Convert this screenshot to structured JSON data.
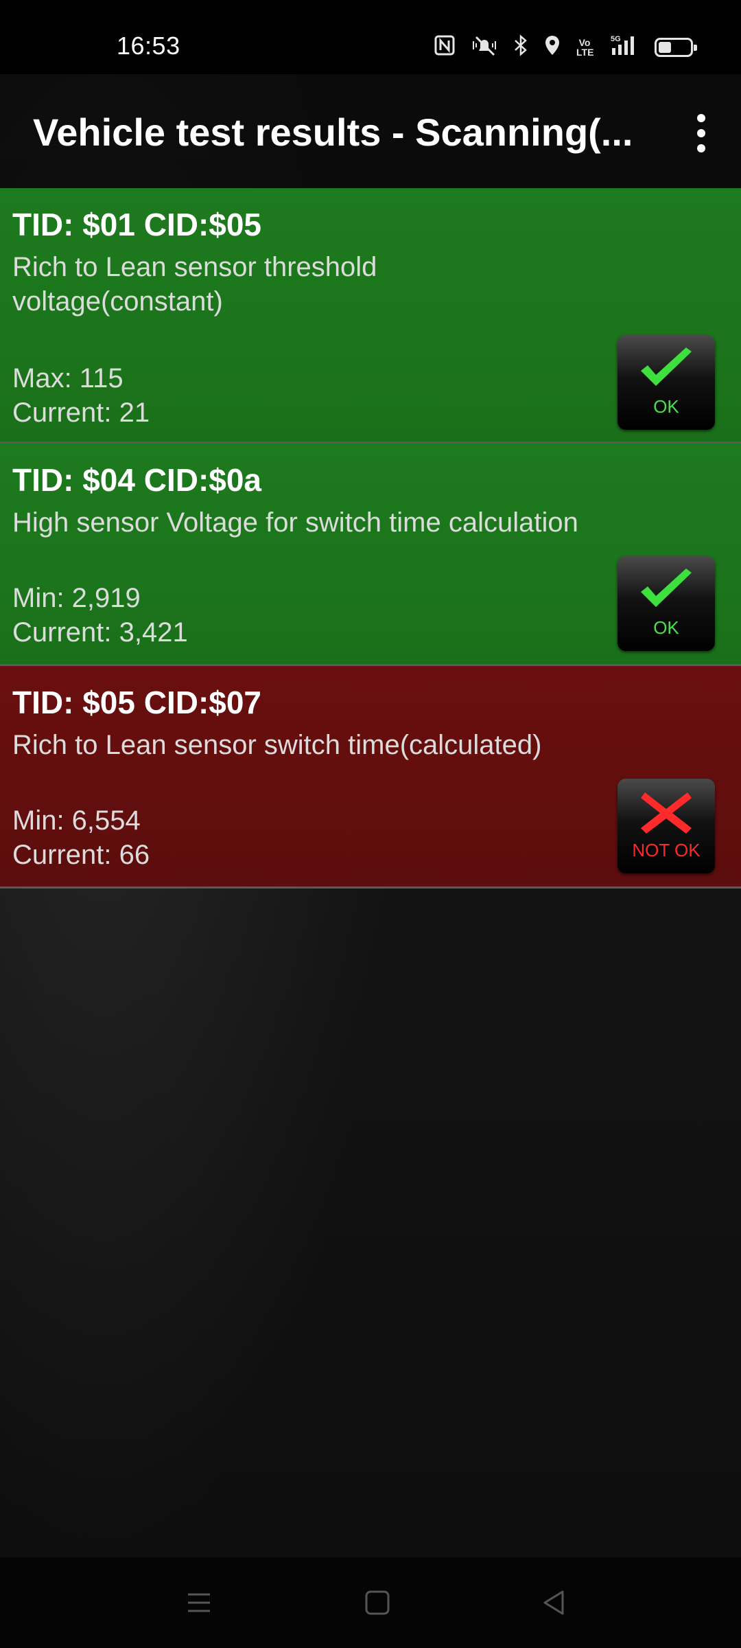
{
  "status_bar": {
    "time": "16:53",
    "icons": [
      "nfc-icon",
      "vibrate-mute-icon",
      "bluetooth-icon",
      "location-icon",
      "volte-icon",
      "signal-5g-icon",
      "battery-icon"
    ],
    "volte_label": "Vo LTE",
    "network_label": "5G"
  },
  "app_bar": {
    "title": "Vehicle test results - Scanning(...",
    "menu_icon": "overflow-menu-icon"
  },
  "colors": {
    "ok_row": "#1e7a1e",
    "not_ok_row": "#6a0f0f",
    "ok_text": "#49e049",
    "not_ok_text": "#ff2828"
  },
  "results": [
    {
      "title": "TID: $01 CID:$05",
      "description": "Rich to Lean sensor threshold voltage(constant)",
      "limit": "Max: 115",
      "current": "Current: 21",
      "status": "ok",
      "badge_label": "OK",
      "badge_icon": "checkmark-icon"
    },
    {
      "title": "TID: $04 CID:$0a",
      "description": "High sensor Voltage for switch time calculation",
      "limit": "Min: 2,919",
      "current": "Current: 3,421",
      "status": "ok",
      "badge_label": "OK",
      "badge_icon": "checkmark-icon"
    },
    {
      "title": "TID: $05 CID:$07",
      "description": "Rich to Lean sensor switch time(calculated)",
      "limit": "Min: 6,554",
      "current": "Current: 66",
      "status": "not_ok",
      "badge_label": "NOT OK",
      "badge_icon": "cross-icon"
    }
  ],
  "nav_bar": {
    "icons": [
      "menu-lines-icon",
      "home-square-icon",
      "back-triangle-icon"
    ]
  }
}
